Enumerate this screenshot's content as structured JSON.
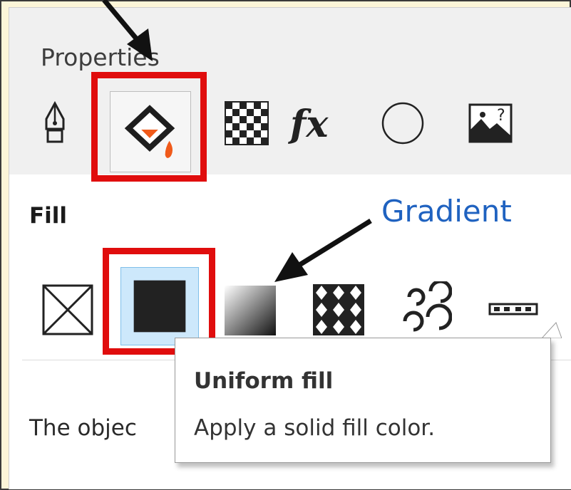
{
  "panel": {
    "title": "Properties"
  },
  "tabs": [
    {
      "id": "outline",
      "icon": "pen-nib-icon"
    },
    {
      "id": "fill",
      "icon": "fill-bucket-icon",
      "selected": true
    },
    {
      "id": "transparency",
      "icon": "checkerboard-icon"
    },
    {
      "id": "effects",
      "icon": "fx-icon",
      "label": "fx"
    },
    {
      "id": "shape",
      "icon": "circle-icon"
    },
    {
      "id": "image",
      "icon": "image-question-icon"
    }
  ],
  "fill": {
    "label": "Fill",
    "types": [
      {
        "id": "no-fill",
        "icon": "no-fill-icon"
      },
      {
        "id": "uniform-fill",
        "icon": "uniform-fill-icon",
        "selected": true
      },
      {
        "id": "gradient-fill",
        "icon": "gradient-fill-icon"
      },
      {
        "id": "pattern-fill",
        "icon": "vector-pattern-icon"
      },
      {
        "id": "texture-fill",
        "icon": "texture-swirl-icon"
      },
      {
        "id": "postscript-fill",
        "icon": "postscript-fill-icon"
      }
    ]
  },
  "description": "The objec",
  "tooltip": {
    "title": "Uniform fill",
    "body": "Apply a solid fill color."
  },
  "annotation": {
    "label": "Gradient"
  },
  "colors": {
    "highlight_red": "#e00d0d",
    "annotation_blue": "#1f62c0",
    "selected_bg": "#cde8fb",
    "accent_orange": "#f05a1a",
    "page_bg": "#fcf5d8"
  }
}
